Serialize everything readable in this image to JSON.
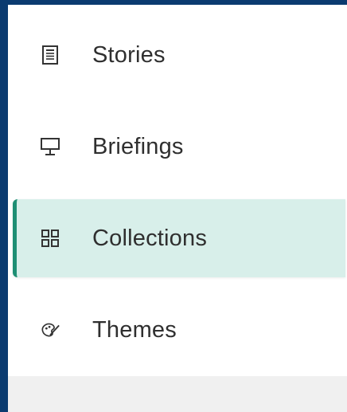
{
  "sidebar": {
    "items": [
      {
        "label": "Stories",
        "icon": "document-icon",
        "active": false
      },
      {
        "label": "Briefings",
        "icon": "presentation-icon",
        "active": false
      },
      {
        "label": "Collections",
        "icon": "grid-icon",
        "active": true
      },
      {
        "label": "Themes",
        "icon": "palette-icon",
        "active": false
      }
    ]
  },
  "colors": {
    "frame": "#0b3b70",
    "active_bg": "#d8efea",
    "active_accent": "#1e8f74",
    "text": "#2f2f2f"
  }
}
